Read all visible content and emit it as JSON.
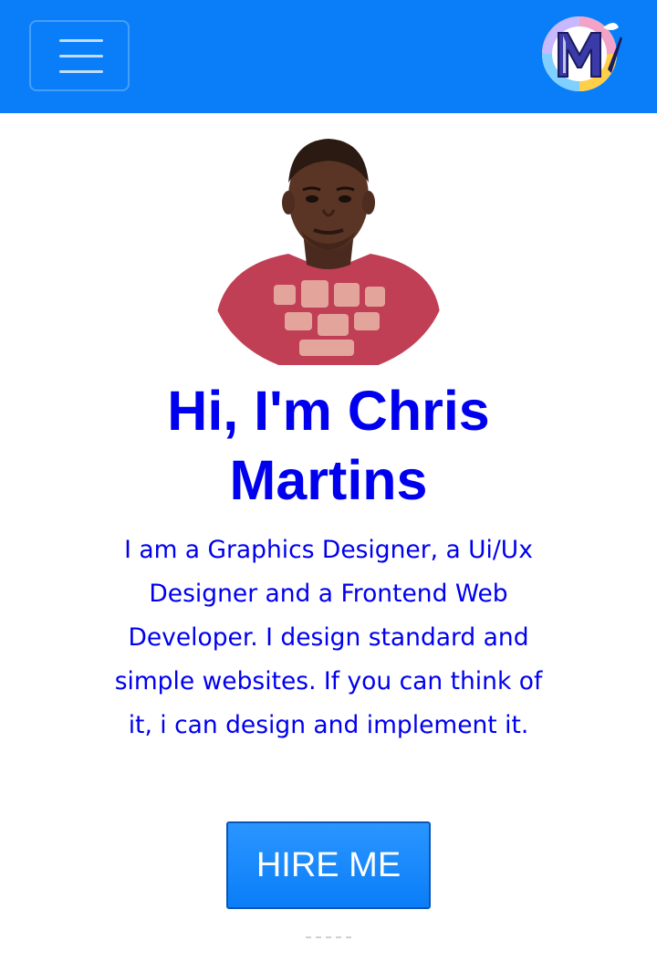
{
  "navbar": {
    "background": "#0a7ef8",
    "menu_icon": "hamburger-menu-icon",
    "logo_icon": "brand-logo-icon",
    "logo_letter": "M"
  },
  "hero": {
    "title": "Hi, I'm Chris Martins",
    "intro": "I am a Graphics Designer, a Ui/Ux Designer and a Frontend Web Developer. I design standard and simple websites. If you can think of it, i can design and implement it.",
    "text_color": "#0000ee",
    "button_label": "HIRE ME",
    "button_color": "#0a7ef8"
  }
}
